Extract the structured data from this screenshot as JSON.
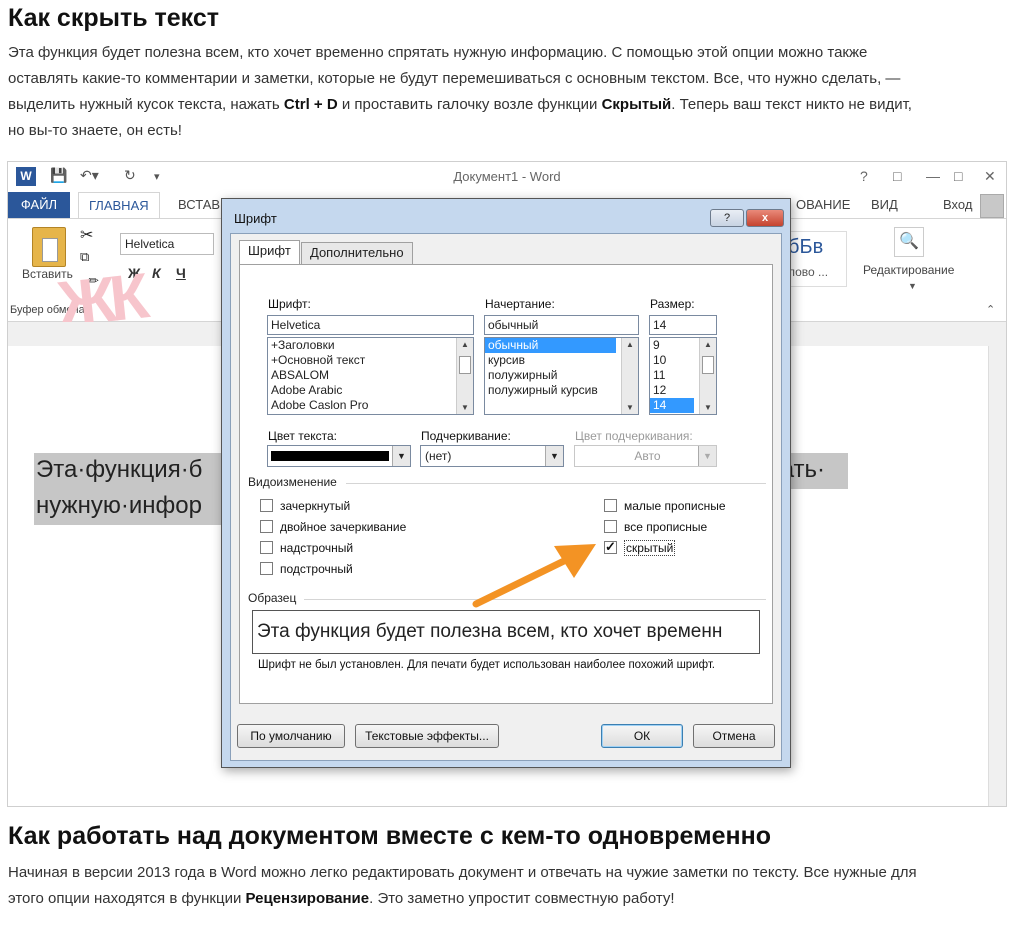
{
  "article": {
    "heading1": "Как скрыть текст",
    "p1_lines": [
      "Эта функция будет полезна всем, кто хочет временно спрятать нужную информацию. С помощью этой опции можно также",
      "оставлять какие-то комментарии и заметки, которые не будут перемешиваться с основным текстом. Все, что нужно сделать, —"
    ],
    "p1_line3_before": "выделить нужный кусок текста, нажать ",
    "p1_line3_bold1": "Ctrl + D",
    "p1_line3_middle": " и проставить галочку возле функции ",
    "p1_line3_bold2": "Скрытый",
    "p1_line3_after": ". Теперь ваш текст никто не видит,",
    "p1_line4": "но вы-то знаете, он есть!",
    "heading2": "Как работать над документом вместе с кем-то одновременно",
    "p2_line1": "Начиная в версии 2013 года в Word можно легко редактировать документ и отвечать на чужие заметки по тексту. Все нужные для",
    "p2_line2_before": "этого опции находятся в функции ",
    "p2_line2_bold": "Рецензирование",
    "p2_line2_after": ". Это заметно упростит совместную работу!"
  },
  "word": {
    "window_title": "Документ1 - Word",
    "help": "?",
    "user": "Вход",
    "tabs": {
      "file": "ФАЙЛ",
      "home": "ГЛАВНАЯ",
      "insert": "ВСТАВ",
      "review": "ОВАНИЕ",
      "view": "ВИД"
    },
    "ribbon": {
      "paste": "Вставить",
      "clipboard_group": "Буфер обмена",
      "font_name": "Helvetica",
      "bold": "Ж",
      "italic": "К",
      "underline": "Ч",
      "styles_preview": "бБв",
      "styles_label": "лово ...",
      "editing": "Редактирование"
    },
    "doc_line1": "Эта·функция·б",
    "doc_line1_right": "тать·",
    "doc_line2": "нужную·инфор"
  },
  "dialog": {
    "title": "Шрифт",
    "help_btn": "?",
    "close_btn": "x",
    "tab_font": "Шрифт",
    "tab_advanced": "Дополнительно",
    "font_label": "Шрифт:",
    "font_value": "Helvetica",
    "font_list": [
      "+Заголовки",
      "+Основной текст",
      "ABSALOM",
      "Adobe Arabic",
      "Adobe Caslon Pro"
    ],
    "style_label": "Начертание:",
    "style_value": "обычный",
    "style_list": [
      "обычный",
      "курсив",
      "полужирный",
      "полужирный курсив"
    ],
    "size_label": "Размер:",
    "size_value": "14",
    "size_list": [
      "9",
      "10",
      "11",
      "12",
      "14"
    ],
    "color_label": "Цвет текста:",
    "underline_label": "Подчеркивание:",
    "underline_value": "(нет)",
    "underline_color_label": "Цвет подчеркивания:",
    "underline_color_value": "Авто",
    "effects_label": "Видоизменение",
    "effects_left": [
      "зачеркнутый",
      "двойное зачеркивание",
      "надстрочный",
      "подстрочный"
    ],
    "effects_right": [
      "малые прописные",
      "все прописные",
      "скрытый"
    ],
    "hidden_checked": true,
    "sample_label": "Образец",
    "sample_text": "Эта функция будет полезна всем, кто хочет временн",
    "note": "Шрифт не был установлен. Для печати будет использован наиболее похожий шрифт.",
    "btn_default": "По умолчанию",
    "btn_effects": "Текстовые эффекты...",
    "btn_ok": "ОК",
    "btn_cancel": "Отмена"
  },
  "colors": {
    "word_blue": "#2b579a",
    "arrow_orange": "#f39324",
    "selection_gray": "#c6c6c6",
    "dialog_frame": "#c5d8ee"
  }
}
